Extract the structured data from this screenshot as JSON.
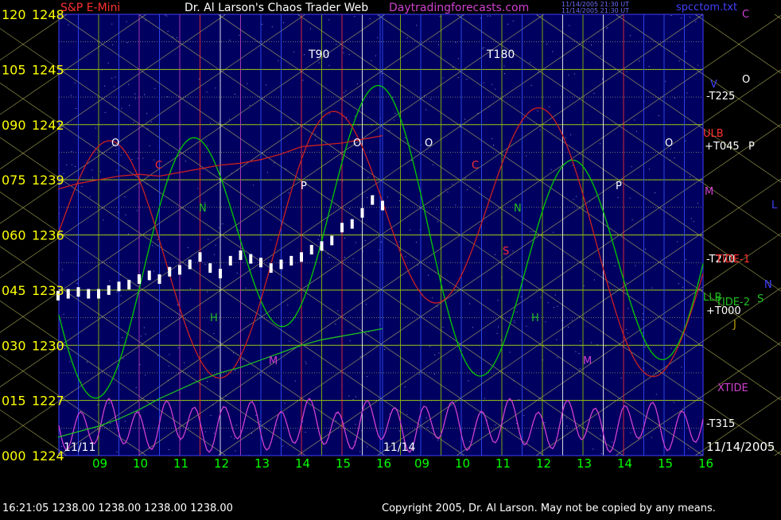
{
  "header": {
    "instrument": "S&P E-Mini",
    "site": "Dr. Al Larson's Chaos Trader Web",
    "url": "Daytradingforecasts.com",
    "filename": "spcctom.txt",
    "tiny_text_1": "11/14/2005 21:30 UT",
    "tiny_text_2": "11/14/2005 21:30 UT"
  },
  "footer": {
    "last_bar": "16:21:05  1238.00 1238.00 1238.00 1238.00",
    "copyright": "Copyright 2005, Dr. Al Larson. May not be copied by any means."
  },
  "colors": {
    "background": "#000000",
    "plot_bg": "#000060",
    "grid": "#90c000",
    "price_axis_text": "#ffff00",
    "time_axis_text": "#00ff00",
    "price_bar": "#ffffff",
    "ulb": "#cc2020",
    "llb": "#20c020",
    "xtide": "#d040d0",
    "cycle": "#00cc00",
    "tide": "#cc2020"
  },
  "chart_data": {
    "type": "line",
    "title": "S&P E-Mini",
    "y_axis": {
      "ticks": [
        {
          "degree": "000",
          "price": 1224
        },
        {
          "degree": "015",
          "price": 1227
        },
        {
          "degree": "030",
          "price": 1230
        },
        {
          "degree": "045",
          "price": 1233
        },
        {
          "degree": "060",
          "price": 1236
        },
        {
          "degree": "075",
          "price": 1239
        },
        {
          "degree": "090",
          "price": 1242
        },
        {
          "degree": "105",
          "price": 1245
        },
        {
          "degree": "120",
          "price": 1248
        }
      ],
      "ylim": [
        1224,
        1248
      ]
    },
    "x_axis": {
      "ticks": [
        "09",
        "10",
        "11",
        "12",
        "13",
        "14",
        "15",
        "16",
        "09",
        "10",
        "11",
        "12",
        "13",
        "14",
        "15",
        "16"
      ],
      "date_labels": [
        "11/11",
        "11/14",
        "11/14/2005"
      ],
      "time_markers": [
        "T90",
        "T180"
      ]
    },
    "price_series": {
      "name": "S&P E-Mini",
      "x": [
        8.0,
        8.25,
        8.5,
        8.75,
        9.0,
        9.25,
        9.5,
        9.75,
        10.0,
        10.25,
        10.5,
        10.75,
        11.0,
        11.25,
        11.5,
        11.75,
        12.0,
        12.25,
        12.5,
        12.75,
        13.0,
        13.25,
        13.5,
        13.75,
        14.0,
        14.25,
        14.5,
        14.75,
        15.0,
        15.25,
        15.5,
        15.75,
        16.0
      ],
      "y": [
        1232.7,
        1232.8,
        1232.9,
        1232.8,
        1232.8,
        1233.0,
        1233.2,
        1233.3,
        1233.6,
        1233.8,
        1233.6,
        1234.0,
        1234.1,
        1234.4,
        1234.8,
        1234.2,
        1233.9,
        1234.6,
        1234.9,
        1234.7,
        1234.5,
        1234.2,
        1234.4,
        1234.6,
        1234.8,
        1235.2,
        1235.4,
        1235.7,
        1236.4,
        1236.6,
        1237.2,
        1237.9,
        1237.6
      ]
    },
    "series": [
      {
        "name": "ULB",
        "x": [
          8,
          8.5,
          9,
          9.5,
          10,
          10.5,
          11,
          11.5,
          12,
          12.5,
          13,
          13.5,
          14,
          14.5,
          15,
          15.5,
          16
        ],
        "y": [
          1238.5,
          1238.8,
          1239.0,
          1239.2,
          1239.3,
          1239.2,
          1239.4,
          1239.6,
          1239.8,
          1239.9,
          1240.1,
          1240.4,
          1240.8,
          1240.9,
          1241.0,
          1241.2,
          1241.4
        ]
      },
      {
        "name": "LLB",
        "x": [
          8,
          8.5,
          9,
          9.5,
          10,
          10.5,
          11,
          11.5,
          12,
          12.5,
          13,
          13.5,
          14,
          14.5,
          15,
          15.5,
          16
        ],
        "y": [
          1225.0,
          1225.3,
          1225.6,
          1226.0,
          1226.5,
          1227.1,
          1227.6,
          1228.1,
          1228.5,
          1228.8,
          1229.2,
          1229.6,
          1230.0,
          1230.3,
          1230.5,
          1230.7,
          1230.9
        ]
      }
    ],
    "right_labels": [
      "-T225",
      "ULB",
      "+T045",
      "M",
      "-T270",
      "TIDE-1",
      "LLB",
      "TIDE-2",
      "+T000",
      "J",
      "XTIDE",
      "-T315",
      "C",
      "O",
      "P",
      "L",
      "N",
      "S",
      "V"
    ],
    "annotations": [
      "O",
      "C",
      "N",
      "H",
      "P",
      "M",
      "S"
    ]
  }
}
